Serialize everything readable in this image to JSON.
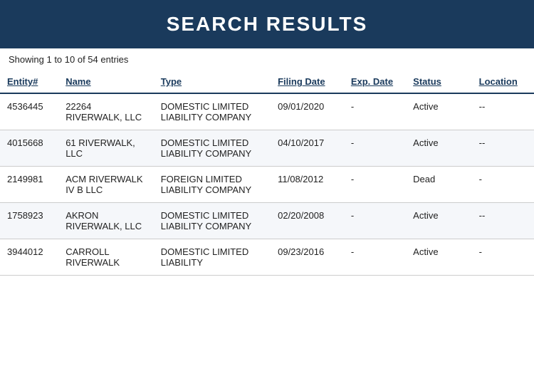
{
  "header": {
    "title": "SEARCH RESULTS"
  },
  "results_info": "Showing 1 to 10 of 54 entries",
  "columns": {
    "entity": "Entity#",
    "name": "Name",
    "type": "Type",
    "filing_date": "Filing Date",
    "exp_date": "Exp. Date",
    "status": "Status",
    "location": "Location"
  },
  "rows": [
    {
      "entity": "4536445",
      "name": "22264 RIVERWALK, LLC",
      "type": "DOMESTIC LIMITED LIABILITY COMPANY",
      "filing_date": "09/01/2020",
      "exp_date": "-",
      "status": "Active",
      "location": "--"
    },
    {
      "entity": "4015668",
      "name": "61 RIVERWALK, LLC",
      "type": "DOMESTIC LIMITED LIABILITY COMPANY",
      "filing_date": "04/10/2017",
      "exp_date": "-",
      "status": "Active",
      "location": "--"
    },
    {
      "entity": "2149981",
      "name": "ACM RIVERWALK IV B LLC",
      "type": "FOREIGN LIMITED LIABILITY COMPANY",
      "filing_date": "11/08/2012",
      "exp_date": "-",
      "status": "Dead",
      "location": "-"
    },
    {
      "entity": "1758923",
      "name": "AKRON RIVERWALK, LLC",
      "type": "DOMESTIC LIMITED LIABILITY COMPANY",
      "filing_date": "02/20/2008",
      "exp_date": "-",
      "status": "Active",
      "location": "--"
    },
    {
      "entity": "3944012",
      "name": "CARROLL RIVERWALK",
      "type": "DOMESTIC LIMITED LIABILITY",
      "filing_date": "09/23/2016",
      "exp_date": "-",
      "status": "Active",
      "location": "-"
    }
  ]
}
